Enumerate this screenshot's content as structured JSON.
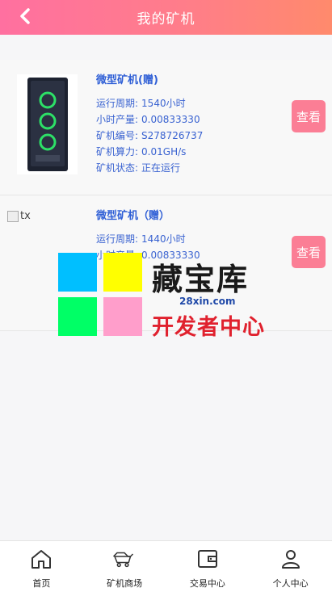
{
  "header": {
    "title": "我的矿机"
  },
  "miners": [
    {
      "name": "微型矿机(赠)",
      "period_label": "运行周期:",
      "period": "1540小时",
      "hourly_label": "小时产量:",
      "hourly": "0.00833330",
      "serial_label": "矿机编号:",
      "serial": "S278726737",
      "power_label": "矿机算力:",
      "power": "0.01GH/s",
      "status_label": "矿机状态:",
      "status": "正在运行",
      "button": "查看"
    },
    {
      "name": "微型矿机（赠）",
      "image_alt": "tx",
      "period_label": "运行周期:",
      "period": "1440小时",
      "hourly_label": "小时产量:",
      "hourly": "0.00833330",
      "button": "查看"
    }
  ],
  "watermark": {
    "title": "藏宝库",
    "url": "28xin.com",
    "subtitle": "开发者中心",
    "colors": [
      "#00bfff",
      "#ffff00",
      "#00ff66",
      "#ff9ecb"
    ]
  },
  "nav": [
    {
      "label": "首页",
      "icon": "home-icon"
    },
    {
      "label": "矿机商场",
      "icon": "mining-cart-icon"
    },
    {
      "label": "交易中心",
      "icon": "wallet-icon"
    },
    {
      "label": "个人中心",
      "icon": "user-icon"
    }
  ]
}
